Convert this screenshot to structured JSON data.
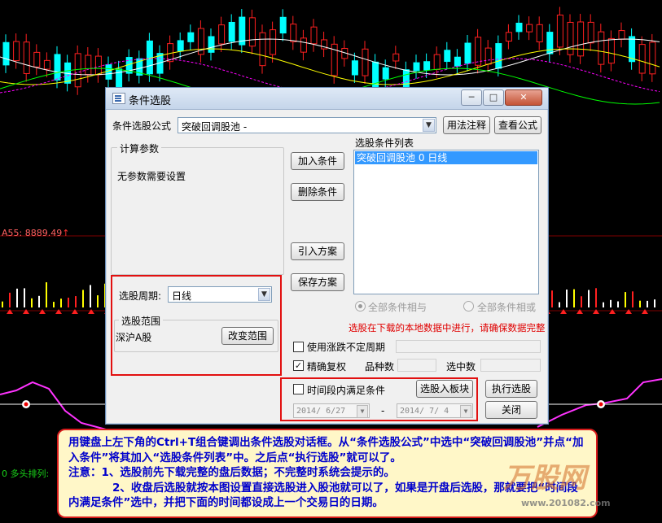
{
  "chart": {
    "ma_label": "A55: 8889.49",
    "ma_arrow": "↑",
    "bottom_label": "0 多头排列:"
  },
  "dialog": {
    "title": "条件选股",
    "formula_label": "条件选股公式",
    "formula_value": "突破回调股池 -",
    "usage_btn": "用法注释",
    "view_formula_btn": "查看公式",
    "params_group_title": "计算参数",
    "params_text": "无参数需要设置",
    "add_cond_btn": "加入条件",
    "del_cond_btn": "删除条件",
    "import_btn": "引入方案",
    "save_btn": "保存方案",
    "cond_list_label": "选股条件列表",
    "cond_list_items": [
      "突破回调股池  0  日线"
    ],
    "period_label": "选股周期:",
    "period_value": "日线",
    "range_group_title": "选股范围",
    "range_value": "深沪A股",
    "change_range_btn": "改变范围",
    "all_and_label": "全部条件相与",
    "all_or_label": "全部条件相或",
    "warning_text": "选股在下载的本地数据中进行，请确保数据完整",
    "use_limit_label": "使用涨跌不定周期",
    "exact_adj_label": "精确复权",
    "count_label": "品种数",
    "selected_label": "选中数",
    "time_range_label": "时间段内满足条件",
    "to_block_btn": "选股入板块",
    "execute_btn": "执行选股",
    "close_btn": "关闭",
    "date_from": "2014/ 6/27",
    "date_sep": "-",
    "date_to": "2014/ 7/ 4"
  },
  "note": {
    "line1": "用键盘上左下角的Ctrl+T组合键调出条件选股对话框。从“条件选股公式”中选中“突破回调股池”并点“加入条件”将其加入“选股条件列表”中。之后点“执行选股”就可以了。",
    "line2": "注意：1、选股前先下载完整的盘后数据；不完整时系统会提示的。",
    "line3": "2、收盘后选股就按本图设置直接选股进入股池就可以了，如果是开盘后选股，那就要把“时间段内满足条件”选中，并把下面的时间都设成上一个交易日的日期。"
  },
  "watermark": {
    "text": "万股网",
    "url": "www.201082.com"
  },
  "colors": {
    "up": "#ff2020",
    "down": "#00ffff",
    "warning": "#e00000",
    "note_text": "#0000cc",
    "note_border": "#d81b1b"
  }
}
